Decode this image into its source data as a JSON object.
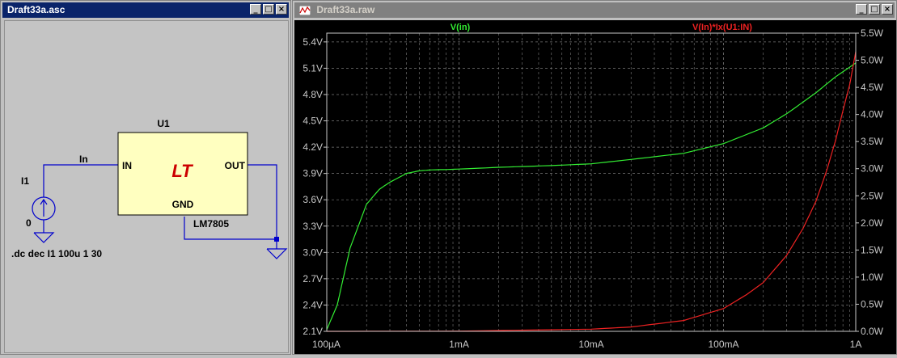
{
  "schematic_window": {
    "title": "Draft33a.asc",
    "component": {
      "ref": "U1",
      "part": "LM7805",
      "logo": "LT",
      "pin_in": "IN",
      "pin_out": "OUT",
      "pin_gnd": "GND"
    },
    "source": {
      "ref": "I1",
      "value": "0"
    },
    "net_label": "In",
    "directive": ".dc dec I1 100u 1 30"
  },
  "plot_window": {
    "title": "Draft33a.raw",
    "colors": {
      "background": "#000000",
      "grid": "#7a7a7a",
      "axis_text": "#c8c8c8",
      "trace1": "#33ee33",
      "trace2": "#ee2222"
    },
    "icon": "waveform-icon"
  },
  "window_buttons": {
    "minimize": "_",
    "maximize": "□",
    "close": "×"
  },
  "chart_data": {
    "type": "line",
    "xscale": "log",
    "xlim": [
      0.0001,
      1
    ],
    "x_ticks": [
      0.0001,
      0.001,
      0.01,
      0.1,
      1
    ],
    "x_tick_labels": [
      "100µA",
      "1mA",
      "10mA",
      "100mA",
      "1A"
    ],
    "left_axis": {
      "ylim": [
        2.1,
        5.5
      ],
      "ticks": [
        2.1,
        2.4,
        2.7,
        3.0,
        3.3,
        3.6,
        3.9,
        4.2,
        4.5,
        4.8,
        5.1,
        5.4
      ],
      "tick_labels": [
        "2.1V",
        "2.4V",
        "2.7V",
        "3.0V",
        "3.3V",
        "3.6V",
        "3.9V",
        "4.2V",
        "4.5V",
        "4.8V",
        "5.1V",
        "5.4V"
      ]
    },
    "right_axis": {
      "ylim": [
        0,
        5.5
      ],
      "ticks": [
        0,
        0.5,
        1.0,
        1.5,
        2.0,
        2.5,
        3.0,
        3.5,
        4.0,
        4.5,
        5.0,
        5.5
      ],
      "tick_labels": [
        "0.0W",
        "0.5W",
        "1.0W",
        "1.5W",
        "2.0W",
        "2.5W",
        "3.0W",
        "3.5W",
        "4.0W",
        "4.5W",
        "5.0W",
        "5.5W"
      ]
    },
    "grid": true,
    "series": [
      {
        "name": "V(in)",
        "axis": "left",
        "x": [
          0.0001,
          0.00012,
          0.00015,
          0.0002,
          0.00025,
          0.0003,
          0.0004,
          0.0005,
          0.0006,
          0.0008,
          0.001,
          0.002,
          0.005,
          0.01,
          0.02,
          0.05,
          0.1,
          0.2,
          0.3,
          0.5,
          0.7,
          1
        ],
        "y": [
          2.12,
          2.4,
          3.05,
          3.55,
          3.72,
          3.8,
          3.9,
          3.93,
          3.94,
          3.945,
          3.95,
          3.97,
          3.99,
          4.01,
          4.06,
          4.13,
          4.24,
          4.42,
          4.58,
          4.82,
          5.0,
          5.16
        ]
      },
      {
        "name": "V(In)*Ix(U1:IN)",
        "axis": "right",
        "x": [
          0.0001,
          0.001,
          0.01,
          0.02,
          0.05,
          0.1,
          0.15,
          0.2,
          0.3,
          0.4,
          0.5,
          0.6,
          0.7,
          0.8,
          0.9,
          1
        ],
        "y": [
          0.0,
          0.004,
          0.04,
          0.08,
          0.2,
          0.42,
          0.68,
          0.9,
          1.4,
          1.9,
          2.4,
          2.95,
          3.5,
          4.07,
          4.55,
          5.16
        ]
      }
    ]
  }
}
